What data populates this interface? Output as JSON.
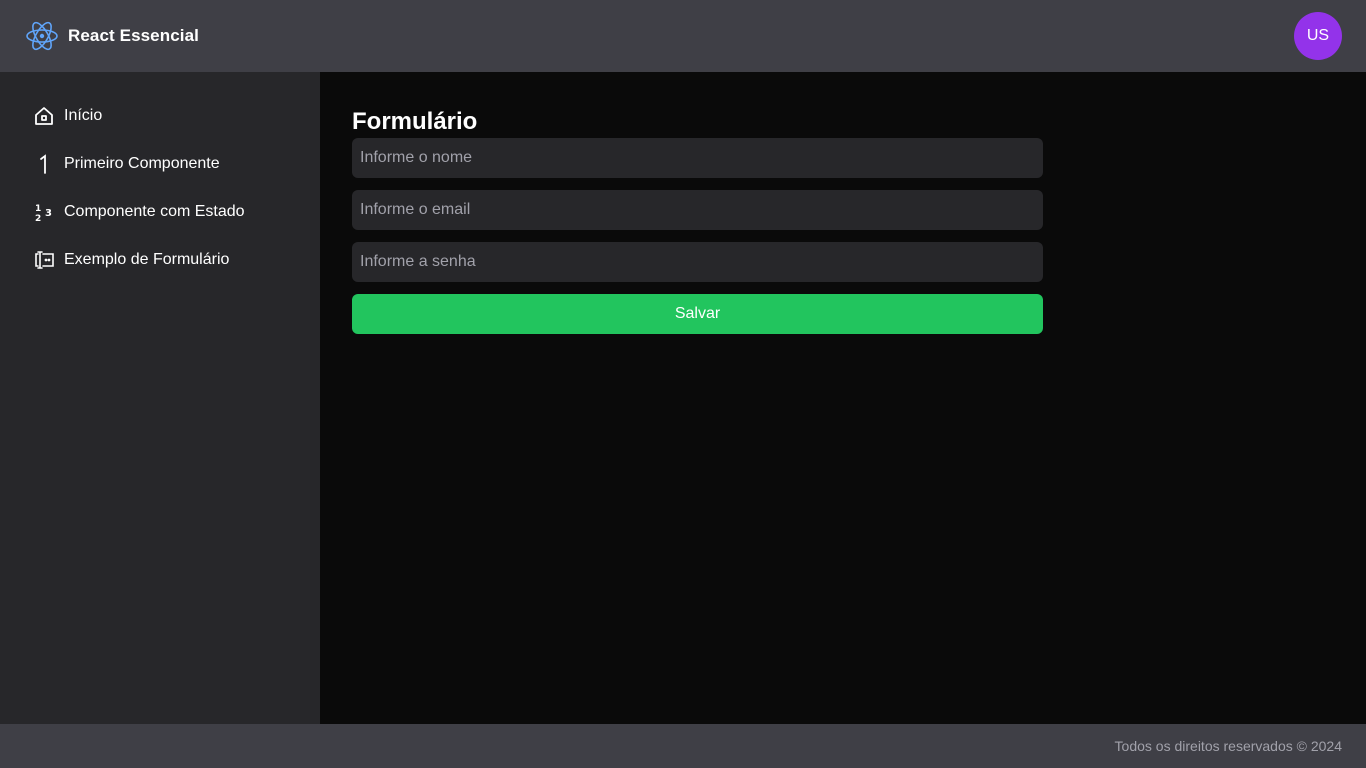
{
  "header": {
    "brand_title": "React Essencial",
    "brand_icon": "react-atom-icon",
    "avatar_initials": "US",
    "colors": {
      "background": "#3f3f46",
      "logo": "#60a5fa",
      "avatar": "#9333ea"
    }
  },
  "sidebar": {
    "items": [
      {
        "label": "Início",
        "icon": "home-icon"
      },
      {
        "label": "Primeiro Componente",
        "icon": "number-one-icon"
      },
      {
        "label": "Componente com Estado",
        "icon": "numbers-123-icon"
      },
      {
        "label": "Exemplo de Formulário",
        "icon": "form-input-icon"
      }
    ],
    "colors": {
      "background": "#27272a"
    }
  },
  "main": {
    "title": "Formulário",
    "form": {
      "name_placeholder": "Informe o nome",
      "email_placeholder": "Informe o email",
      "password_placeholder": "Informe a senha",
      "save_label": "Salvar"
    },
    "colors": {
      "background": "#0a0a0a",
      "field": "#27272a",
      "button": "#22c55e"
    }
  },
  "footer": {
    "text": "Todos os direitos reservados © 2024"
  }
}
